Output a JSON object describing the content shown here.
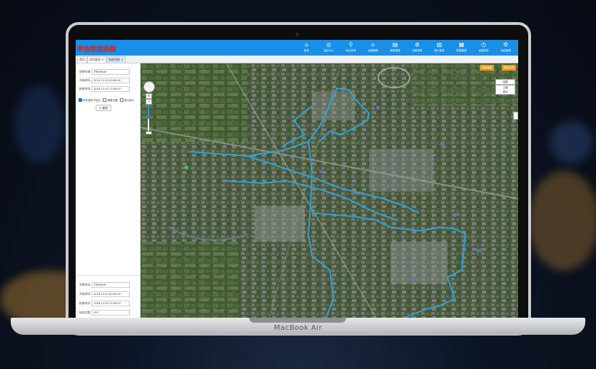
{
  "device": {
    "brand": "MacBook Air"
  },
  "app": {
    "title": "平台定位系统",
    "nav": [
      {
        "icon": "home-icon",
        "label": "首页"
      },
      {
        "icon": "monitor-icon",
        "label": "监控中心"
      },
      {
        "icon": "search-icon",
        "label": "综合查询"
      },
      {
        "icon": "bank-icon",
        "label": "运营管理"
      },
      {
        "icon": "document-icon",
        "label": "报表管理"
      },
      {
        "icon": "settings-circle-icon",
        "label": "设备报表"
      },
      {
        "icon": "chart-icon",
        "label": "统计报表"
      },
      {
        "icon": "form-icon",
        "label": "数据管理"
      },
      {
        "icon": "clock-icon",
        "label": "运营报表"
      },
      {
        "icon": "gear-icon",
        "label": "系统管理"
      }
    ]
  },
  "tabs": [
    {
      "label": "首页"
    },
    {
      "label": "实时监控 ×"
    },
    {
      "label": "轨迹回放 ×"
    }
  ],
  "query_form": {
    "plate_label": "选择车辆:",
    "plate_value": "沪B3961B",
    "start_label": "开始时间:",
    "start_value": "2018-12-02 00:00:00",
    "end_label": "结束时间:",
    "end_value": "2018-12-03 15:56:07",
    "options": [
      {
        "label": "停车超时不显示",
        "checked": true
      },
      {
        "label": "报警位置",
        "checked": false
      },
      {
        "label": "显示箭头",
        "checked": false
      }
    ],
    "query_button": "查询"
  },
  "result_info": {
    "plate_label": "车牌号码:",
    "plate_value": "沪B3961B",
    "start_label": "开始时间:",
    "start_value": "2018-12-02 00:00:00",
    "end_label": "结束时间:",
    "end_value": "2018-12-03 15:56:07",
    "count_label": "轨迹点数:",
    "count_value": "437"
  },
  "map": {
    "buttons": [
      "测量地图",
      "清除地图"
    ],
    "map_type": "地图",
    "map_type_options": [
      "卫星",
      "混合"
    ],
    "track_color": "#2fa3e0"
  }
}
